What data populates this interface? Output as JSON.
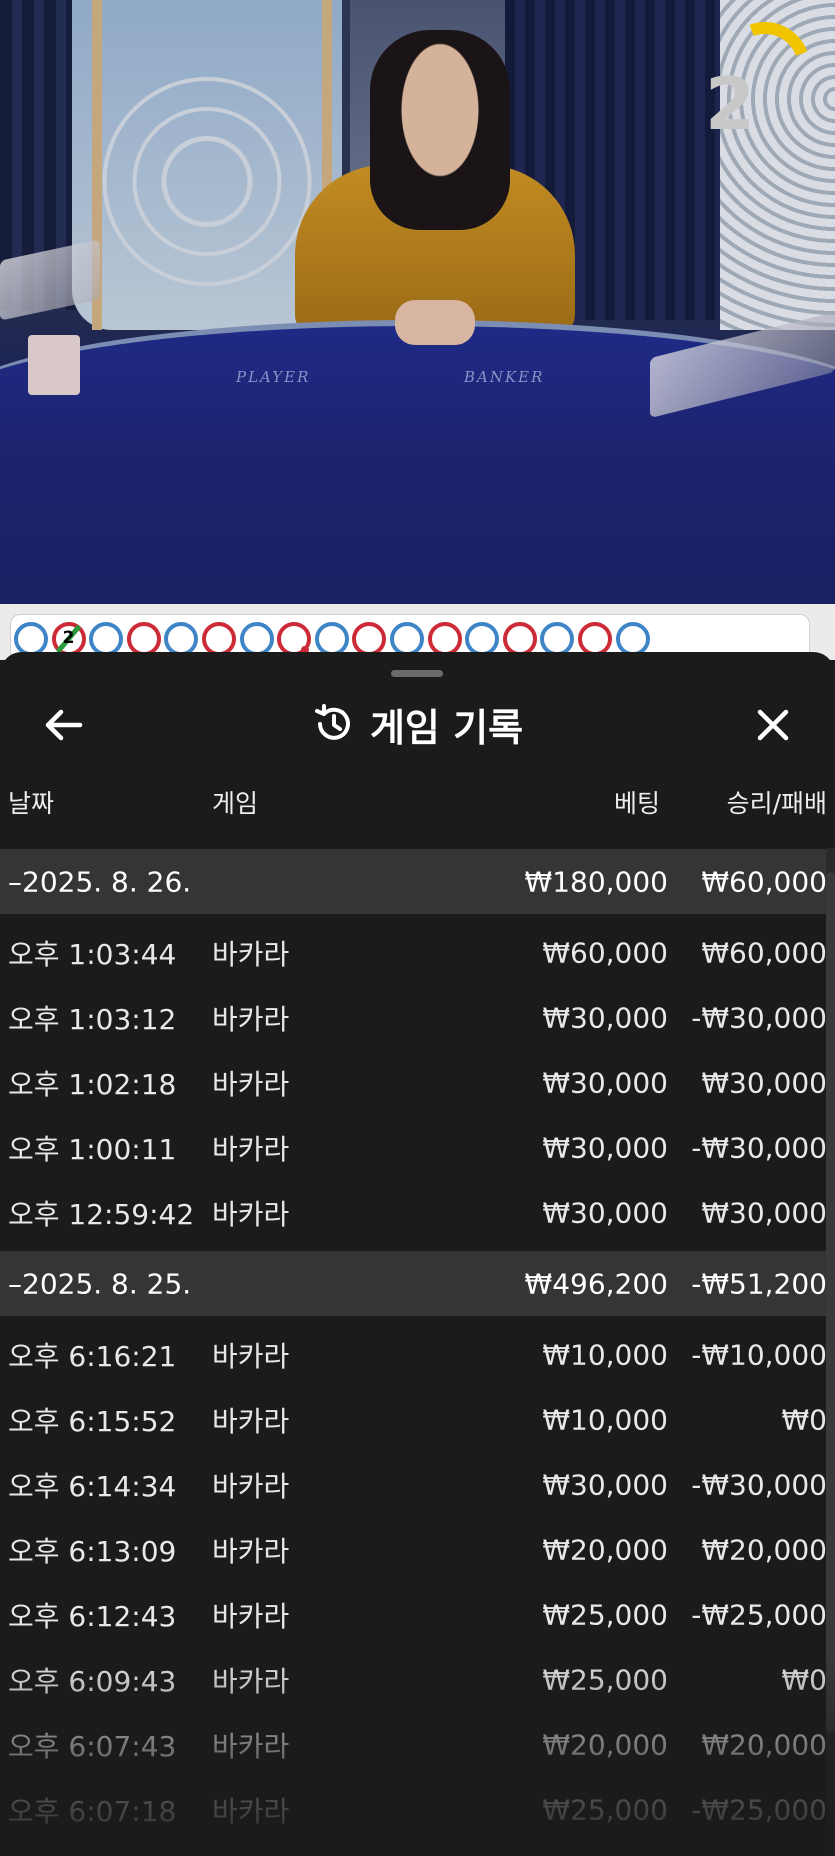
{
  "video": {
    "round_counter": "2",
    "table_labels": {
      "player": "PLAYER",
      "banker": "BANKER"
    }
  },
  "roadmap": {
    "beads": [
      "blue",
      "red",
      "blue",
      "red",
      "blue",
      "red",
      "blue",
      "red",
      "blue",
      "red",
      "blue",
      "red",
      "blue",
      "red",
      "blue",
      "red",
      "blue"
    ],
    "first_red_bead_number": "2"
  },
  "panel": {
    "title": "게임 기록",
    "icons": {
      "back": "arrow-left-icon",
      "history": "history-icon",
      "close": "close-icon"
    },
    "columns": {
      "date": "날짜",
      "game": "게임",
      "bet": "베팅",
      "result": "승리/패배"
    },
    "rows": [
      {
        "type": "day",
        "time": "–2025. 8. 26.",
        "game": "",
        "bet": "₩180,000",
        "result": "₩60,000"
      },
      {
        "type": "game",
        "time": "오후 1:03:44",
        "game": "바카라",
        "bet": "₩60,000",
        "result": "₩60,000"
      },
      {
        "type": "game",
        "time": "오후 1:03:12",
        "game": "바카라",
        "bet": "₩30,000",
        "result": "-₩30,000"
      },
      {
        "type": "game",
        "time": "오후 1:02:18",
        "game": "바카라",
        "bet": "₩30,000",
        "result": "₩30,000"
      },
      {
        "type": "game",
        "time": "오후 1:00:11",
        "game": "바카라",
        "bet": "₩30,000",
        "result": "-₩30,000"
      },
      {
        "type": "game",
        "time": "오후 12:59:42",
        "game": "바카라",
        "bet": "₩30,000",
        "result": "₩30,000"
      },
      {
        "type": "day",
        "time": "–2025. 8. 25.",
        "game": "",
        "bet": "₩496,200",
        "result": "-₩51,200"
      },
      {
        "type": "game",
        "time": "오후 6:16:21",
        "game": "바카라",
        "bet": "₩10,000",
        "result": "-₩10,000"
      },
      {
        "type": "game",
        "time": "오후 6:15:52",
        "game": "바카라",
        "bet": "₩10,000",
        "result": "₩0"
      },
      {
        "type": "game",
        "time": "오후 6:14:34",
        "game": "바카라",
        "bet": "₩30,000",
        "result": "-₩30,000"
      },
      {
        "type": "game",
        "time": "오후 6:13:09",
        "game": "바카라",
        "bet": "₩20,000",
        "result": "₩20,000"
      },
      {
        "type": "game",
        "time": "오후 6:12:43",
        "game": "바카라",
        "bet": "₩25,000",
        "result": "-₩25,000"
      },
      {
        "type": "game",
        "time": "오후 6:09:43",
        "game": "바카라",
        "bet": "₩25,000",
        "result": "₩0"
      },
      {
        "type": "game",
        "time": "오후 6:07:43",
        "game": "바카라",
        "bet": "₩20,000",
        "result": "₩20,000"
      },
      {
        "type": "game",
        "time": "오후 6:07:18",
        "game": "바카라",
        "bet": "₩25,000",
        "result": "-₩25,000"
      }
    ]
  },
  "colors": {
    "panel_bg": "#1b1b1b",
    "day_row_bg": "#353535",
    "bead_blue": "#3d85c6",
    "bead_red": "#cc2a36",
    "timer_yellow": "#f0c500"
  }
}
